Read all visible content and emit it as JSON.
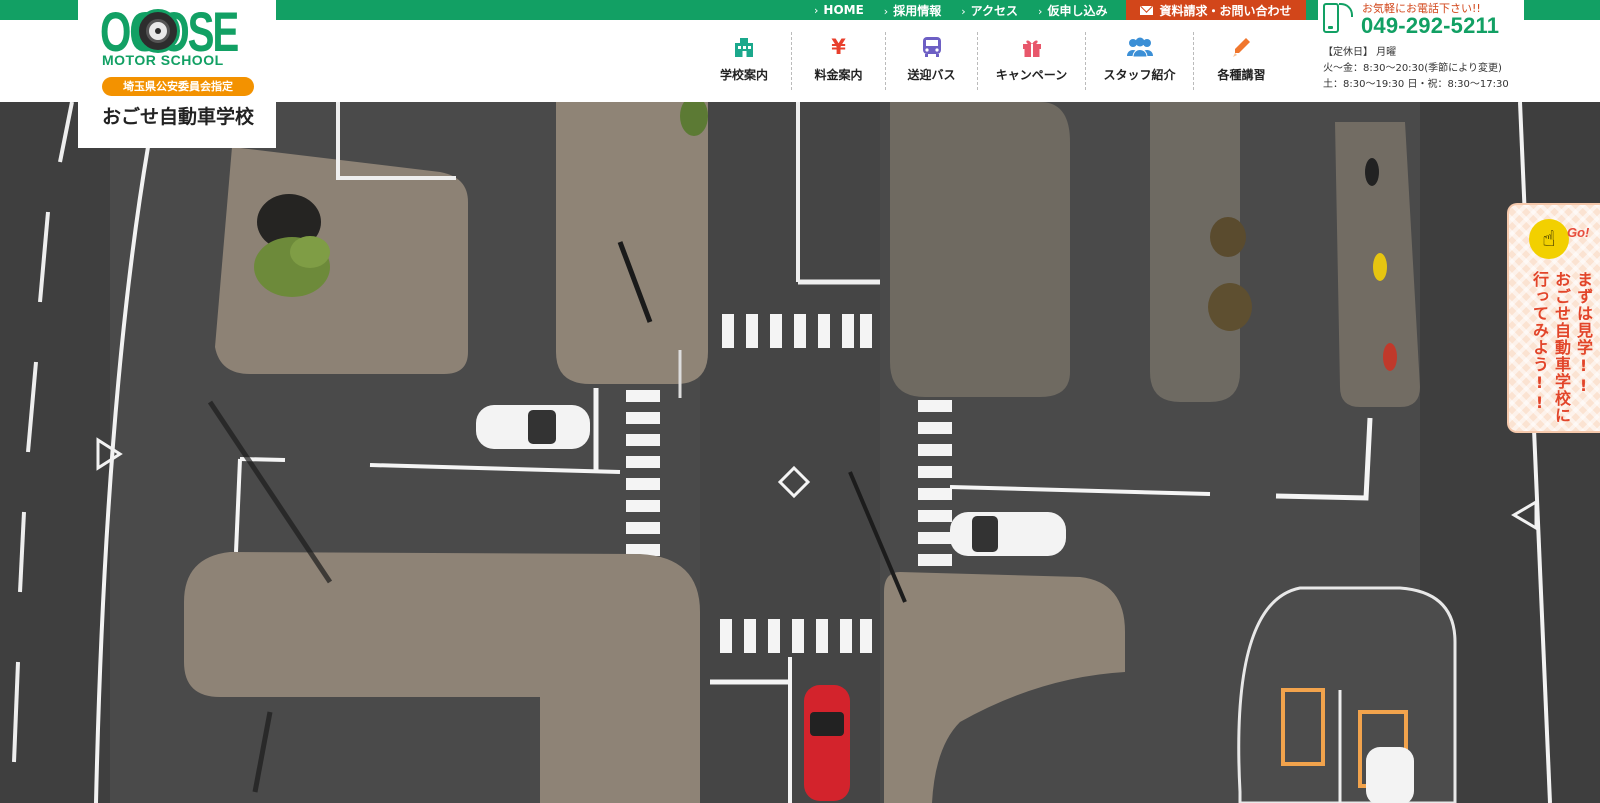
{
  "header": {
    "top_nav": [
      {
        "label": "HOME"
      },
      {
        "label": "採用情報"
      },
      {
        "label": "アクセス"
      },
      {
        "label": "仮申し込み"
      }
    ],
    "contact_button": "資料請求・お問い合わせ",
    "logo": {
      "main": "OGOSE",
      "sub": "MOTOR SCHOOL",
      "badge": "埼玉県公安委員会指定",
      "japanese_name": "おごせ自動車学校"
    },
    "main_nav": [
      {
        "label": "学校案内",
        "icon": "building-icon",
        "color": "#1ba88c"
      },
      {
        "label": "料金案内",
        "icon": "yen-icon",
        "color": "#e8402d"
      },
      {
        "label": "送迎バス",
        "icon": "bus-icon",
        "color": "#6d5fc4"
      },
      {
        "label": "キャンペーン",
        "icon": "gift-icon",
        "color": "#e8576b"
      },
      {
        "label": "スタッフ紹介",
        "icon": "staff-icon",
        "color": "#3b8fd6"
      },
      {
        "label": "各種講習",
        "icon": "pencil-icon",
        "color": "#f0762d"
      }
    ],
    "phone": {
      "catch": "お気軽にお電話下さい!!",
      "number": "049-292-5211",
      "holiday": "【定休日】 月曜",
      "hours_weekday": "火～金：8:30～20:30(季節により変更)",
      "hours_weekend": "土：8:30～19:30 日・祝：8:30～17:30"
    }
  },
  "side_banner": {
    "go": "Go!",
    "line1": "まずは見学!!",
    "line2": "おごせ自動車学校に",
    "line3": "行ってみよう!!"
  },
  "colors": {
    "brand_green": "#12a064",
    "accent_orange": "#f39200",
    "contact_red": "#d2461a"
  }
}
